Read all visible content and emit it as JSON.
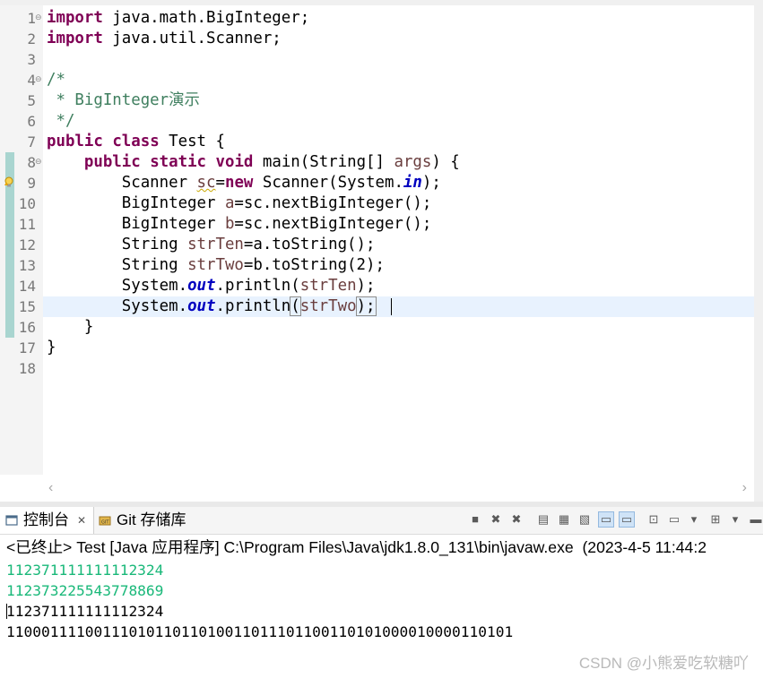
{
  "editor": {
    "line_numbers": [
      "1",
      "2",
      "3",
      "4",
      "5",
      "6",
      "7",
      "8",
      "9",
      "10",
      "11",
      "12",
      "13",
      "14",
      "15",
      "16",
      "17",
      "18"
    ],
    "code": {
      "l1": {
        "kw": "import",
        "rest": " java.math.BigInteger;"
      },
      "l2": {
        "kw": "import",
        "rest": " java.util.Scanner;"
      },
      "l4": {
        "text": "/*"
      },
      "l5": {
        "text": " * BigInteger演示"
      },
      "l6": {
        "text": " */"
      },
      "l7": {
        "kw1": "public",
        "kw2": "class",
        "rest": " Test {"
      },
      "l8": {
        "indent": "    ",
        "kw1": "public",
        "kw2": "static",
        "kw3": "void",
        "pre": " main(String[] ",
        "var": "args",
        "post": ") {"
      },
      "l9": {
        "indent": "        ",
        "pre": "Scanner ",
        "var": "sc",
        "mid": "=",
        "kw": "new",
        "post": " Scanner(System.",
        "field": "in",
        "end": ");"
      },
      "l10": {
        "indent": "        ",
        "pre": "BigInteger ",
        "var": "a",
        "mid": "=sc.nextBigInteger();"
      },
      "l11": {
        "indent": "        ",
        "pre": "BigInteger ",
        "var": "b",
        "mid": "=sc.nextBigInteger();"
      },
      "l12": {
        "indent": "        ",
        "pre": "String ",
        "var": "strTen",
        "mid": "=a.toString();"
      },
      "l13": {
        "indent": "        ",
        "pre": "String ",
        "var": "strTwo",
        "mid": "=b.toString(2);"
      },
      "l14": {
        "indent": "        ",
        "pre": "System.",
        "field": "out",
        "mid": ".println(",
        "var": "strTen",
        "end": ");"
      },
      "l15": {
        "indent": "        ",
        "pre": "System.",
        "field": "out",
        "mid": ".println",
        "paren": "(",
        "var": "strTwo",
        "end": ");"
      },
      "l16": {
        "text": "    }"
      },
      "l17": {
        "text": "}"
      }
    }
  },
  "panel": {
    "tabs": [
      {
        "label": "控制台",
        "close": "✕"
      },
      {
        "label": "Git 存储库"
      }
    ]
  },
  "console": {
    "status": "<已终止> Test [Java 应用程序] C:\\Program Files\\Java\\jdk1.8.0_131\\bin\\javaw.exe  (2023-4-5 11:44:2",
    "lines": [
      "112371111111112324",
      "112373225543778869",
      "112371111111112324",
      "1100011110011101011011010011011101100110101000010000110101"
    ]
  },
  "watermark": "CSDN @小熊爱吃软糖吖",
  "colors": {
    "keyword": "#7f0055",
    "comment": "#3f7f5f",
    "local_var": "#6a3e3e",
    "field": "#0000c0",
    "console_input": "#19b879",
    "line_highlight": "#e8f2fe"
  }
}
